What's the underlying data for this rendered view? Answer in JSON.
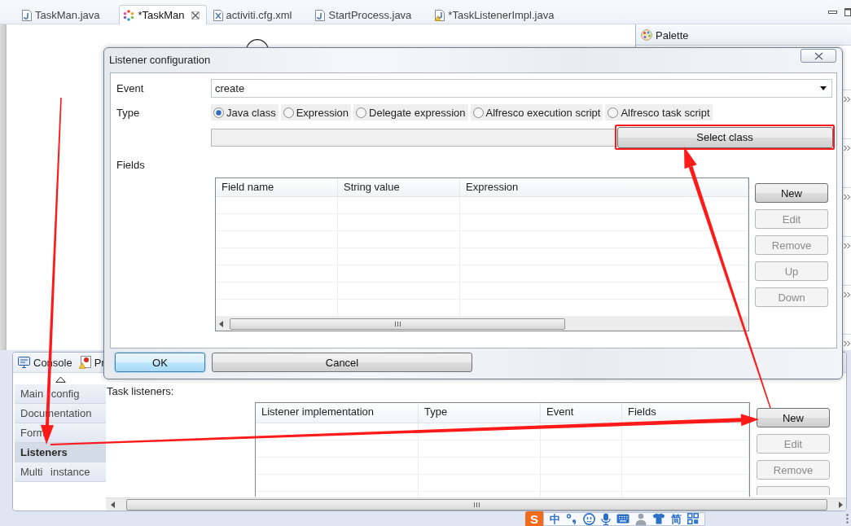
{
  "editor_tabs": [
    {
      "label": "TaskMan.java",
      "kind": "java",
      "selected": false
    },
    {
      "label": "*TaskMan",
      "kind": "diagram",
      "selected": true
    },
    {
      "label": "activiti.cfg.xml",
      "kind": "xml",
      "selected": false
    },
    {
      "label": "StartProcess.java",
      "kind": "java",
      "selected": false
    },
    {
      "label": "*TaskListenerImpl.java",
      "kind": "java-warning",
      "selected": false
    }
  ],
  "palette": {
    "title": "Palette"
  },
  "dialog": {
    "title": "Listener configuration",
    "event": {
      "label": "Event",
      "value": "create"
    },
    "type": {
      "label": "Type",
      "options": [
        {
          "label": "Java class",
          "selected": true
        },
        {
          "label": "Expression",
          "selected": false
        },
        {
          "label": "Delegate expression",
          "selected": false
        },
        {
          "label": "Alfresco execution script",
          "selected": false
        },
        {
          "label": "Alfresco task script",
          "selected": false
        }
      ]
    },
    "select_class": {
      "label": "Select class",
      "highlighted": true
    },
    "fields": {
      "label": "Fields",
      "columns": [
        "Field name",
        "String value",
        "Expression"
      ],
      "buttons": [
        {
          "label": "New",
          "disabled": false
        },
        {
          "label": "Edit",
          "disabled": true
        },
        {
          "label": "Remove",
          "disabled": true
        },
        {
          "label": "Up",
          "disabled": true
        },
        {
          "label": "Down",
          "disabled": true
        }
      ]
    },
    "buttons": [
      {
        "label": "OK",
        "default": true
      },
      {
        "label": "Cancel",
        "default": false
      }
    ]
  },
  "properties_view": {
    "tabs": [
      {
        "label": "Console",
        "kind": "console"
      },
      {
        "label": "Pr",
        "kind": "problems"
      }
    ],
    "sections": [
      {
        "label": "Main config",
        "selected": false
      },
      {
        "label": "Documentation",
        "selected": false
      },
      {
        "label": "Form",
        "selected": false
      },
      {
        "label": "Listeners",
        "selected": true
      },
      {
        "label": "Multi instance",
        "selected": false
      }
    ],
    "task_listeners": {
      "label": "Task listeners:",
      "columns": [
        "Listener implementation",
        "Type",
        "Event",
        "Fields"
      ],
      "buttons": [
        {
          "label": "New",
          "disabled": false
        },
        {
          "label": "Edit",
          "disabled": true
        },
        {
          "label": "Remove",
          "disabled": true
        },
        {
          "disabled": true
        }
      ]
    }
  },
  "status_bar": {
    "ime_toolbar": [
      {
        "kind": "logo",
        "text": "S"
      },
      {
        "kind": "text",
        "text": "中"
      },
      {
        "kind": "punctuation"
      },
      {
        "kind": "smiley"
      },
      {
        "kind": "microphone"
      },
      {
        "kind": "keyboard"
      },
      {
        "kind": "person"
      },
      {
        "kind": "shirt"
      },
      {
        "kind": "text",
        "text": "简"
      },
      {
        "kind": "grid"
      }
    ]
  }
}
